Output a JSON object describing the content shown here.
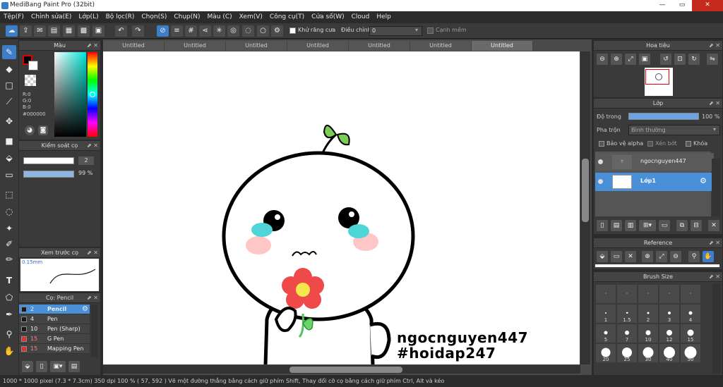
{
  "window": {
    "title": "MediBang Paint Pro (32bit)",
    "min": "—",
    "max": "▭",
    "close": "✕"
  },
  "menu": [
    "Tệp(F)",
    "Chỉnh sửa(E)",
    "Lớp(L)",
    "Bộ lọc(R)",
    "Chọn(S)",
    "Chụp(N)",
    "Màu (C)",
    "Xem(V)",
    "Công cụ(T)",
    "Cửa số(W)",
    "Cloud",
    "Help"
  ],
  "toolbar": {
    "antialias_label": "Khử răng cưa",
    "adjust_label": "Điều chỉnh",
    "adjust_value": "0",
    "edge_label": "Cạnh mềm"
  },
  "tabs": [
    "Untitled",
    "Untitled",
    "Untitled",
    "Untitled",
    "Untitled",
    "Untitled",
    "Untitled"
  ],
  "color_panel": {
    "title": "Màu",
    "r": "R:0",
    "g": "G:0",
    "b": "B:0",
    "hex": "#000000"
  },
  "brush_control": {
    "title": "Kiểm soát cọ",
    "size": "2",
    "opacity": "99 %"
  },
  "preview": {
    "title": "Xem trước cọ",
    "size": "0.15mm"
  },
  "brush_list": {
    "title": "Cọ: Pencil",
    "items": [
      {
        "size": "2",
        "name": "Pencil",
        "selected": true,
        "color": "#1a1a1a"
      },
      {
        "size": "4",
        "name": "Pen",
        "selected": false,
        "color": "#1a1a1a"
      },
      {
        "size": "10",
        "name": "Pen (Sharp)",
        "selected": false,
        "color": "#1a1a1a"
      },
      {
        "size": "15",
        "name": "G Pen",
        "selected": false,
        "color": "#e03030"
      },
      {
        "size": "15",
        "name": "Mapping Pen",
        "selected": false,
        "color": "#e03030"
      }
    ]
  },
  "navigator": {
    "title": "Hoa tiêu"
  },
  "layer_panel": {
    "title": "Lớp",
    "opacity_label": "Độ trong",
    "opacity_value": "100 %",
    "blend_label": "Pha trộn",
    "blend_value": "Bình thường",
    "protect_alpha": "Bảo vệ alpha",
    "clip": "Xén bớt",
    "lock": "Khóa",
    "layers": [
      {
        "name": "ngocnguyen447",
        "selected": false
      },
      {
        "name": "Lớp1",
        "selected": true
      }
    ]
  },
  "reference": {
    "title": "Reference"
  },
  "brush_size": {
    "title": "Brush Size",
    "sizes": [
      "1",
      "1.5",
      "2",
      "3",
      "4",
      "5",
      "7",
      "10",
      "12",
      "15",
      "20",
      "25",
      "30",
      "40",
      "50"
    ]
  },
  "canvas": {
    "line1": "ngocnguyen447",
    "line2": "#hoidap247"
  },
  "status": {
    "text": "1000 * 1000 pixel   (7.3 * 7.3cm)   350 dpi   100 %   ( 57, 592 )   Vẽ một đường thẳng bằng cách giữ phím Shift, Thay đổi cỡ cọ bằng cách giữ phím Ctrl, Alt và kéo"
  }
}
